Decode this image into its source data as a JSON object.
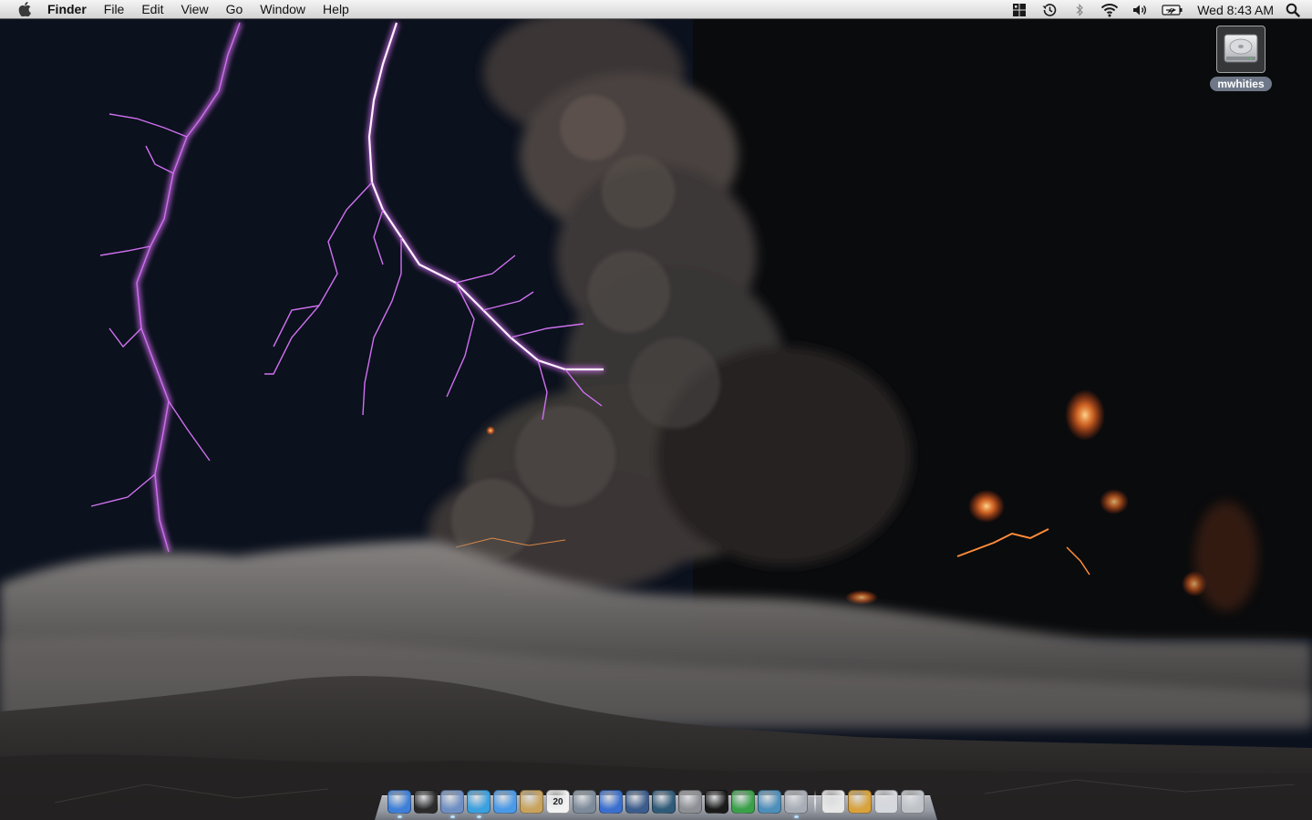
{
  "menubar": {
    "app_name": "Finder",
    "menus": [
      "File",
      "Edit",
      "View",
      "Go",
      "Window",
      "Help"
    ],
    "status_icons": [
      "spaces-icon",
      "time-machine-icon",
      "bluetooth-icon",
      "wifi-icon",
      "volume-icon",
      "battery-icon"
    ],
    "clock": "Wed 8:43 AM"
  },
  "desktop": {
    "disk_label": "mwhities",
    "wallpaper": "volcano-lightning-wallpaper"
  },
  "dock": {
    "apps": [
      {
        "name": "finder",
        "color": "#3d7fd8",
        "running": true
      },
      {
        "name": "dashboard",
        "color": "#2b2b2b",
        "running": false
      },
      {
        "name": "mail",
        "color": "#6f8fc4",
        "running": true
      },
      {
        "name": "safari",
        "color": "#3aa0e0",
        "running": true
      },
      {
        "name": "ichat",
        "color": "#4a9ae8",
        "running": false
      },
      {
        "name": "address-book",
        "color": "#c9a35c",
        "running": false
      },
      {
        "name": "ical",
        "color": "#f2f2f2",
        "running": false,
        "label": "20"
      },
      {
        "name": "iphoto",
        "color": "#7c8a99",
        "running": false
      },
      {
        "name": "itunes",
        "color": "#3a6fd0",
        "running": false
      },
      {
        "name": "spaces",
        "color": "#3b5c8c",
        "running": false
      },
      {
        "name": "time-machine",
        "color": "#2f5a78",
        "running": false
      },
      {
        "name": "system-preferences",
        "color": "#8d8f94",
        "running": false
      },
      {
        "name": "terminal",
        "color": "#1a1a1a",
        "running": false
      },
      {
        "name": "adium",
        "color": "#3aa14a",
        "running": false
      },
      {
        "name": "preview",
        "color": "#4c8fba",
        "running": false
      },
      {
        "name": "activity-monitor",
        "color": "#a8adb5",
        "running": true
      }
    ],
    "stacks": [
      {
        "name": "documents-stack",
        "color": "#e7e7e7"
      },
      {
        "name": "downloads-stack",
        "color": "#d9a23a"
      },
      {
        "name": "applications-stack",
        "color": "#d5d8dd"
      },
      {
        "name": "trash",
        "color": "#bfc3c8"
      }
    ]
  }
}
